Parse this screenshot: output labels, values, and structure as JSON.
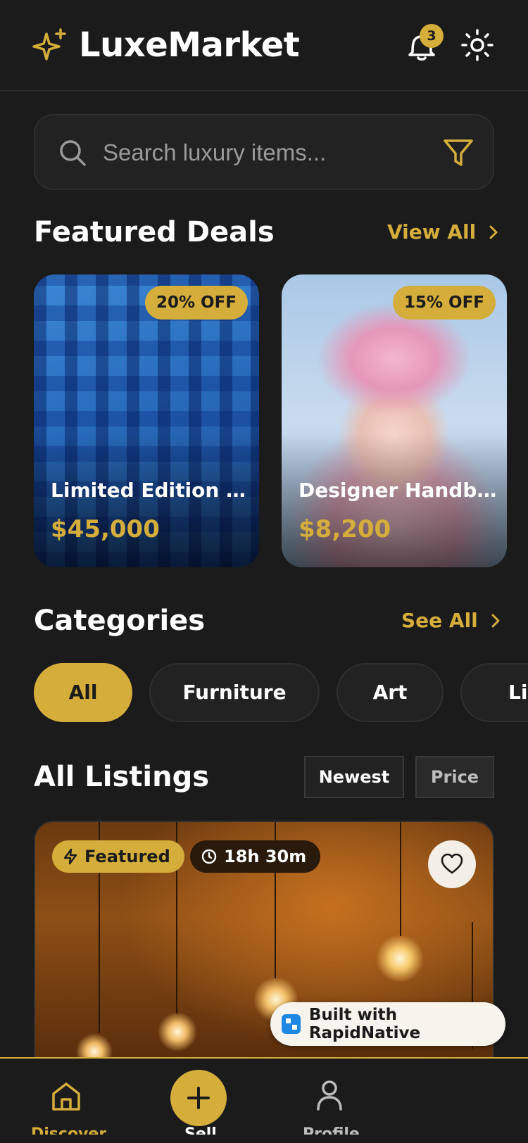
{
  "header": {
    "brand_title": "LuxeMarket",
    "notification_count": "3",
    "icons": [
      "sparkle-icon",
      "bell-icon",
      "sun-icon"
    ]
  },
  "search": {
    "placeholder": "Search luxury items...",
    "value": ""
  },
  "featured": {
    "title": "Featured Deals",
    "link_label": "View All",
    "deals": [
      {
        "badge": "20% OFF",
        "name": "Limited Edition W...",
        "price": "$45,000"
      },
      {
        "badge": "15% OFF",
        "name": "Designer Handbag",
        "price": "$8,200"
      }
    ]
  },
  "categories": {
    "title": "Categories",
    "link_label": "See All",
    "items": [
      "All",
      "Furniture",
      "Art",
      "Lig"
    ],
    "selected": "All"
  },
  "listings": {
    "title": "All Listings",
    "sort_options": [
      "Newest",
      "Price"
    ],
    "selected_sort": "Newest",
    "first_item": {
      "featured_label": "Featured",
      "time_left": "18h 30m"
    }
  },
  "promo": {
    "label": "Built with RapidNative"
  },
  "tabbar": {
    "labels": [
      "Discover",
      "Sell",
      "Profile"
    ],
    "active": "Discover"
  },
  "colors": {
    "background": "#1b1b1b",
    "accent": "#d4ad3b",
    "card": "#222222"
  }
}
